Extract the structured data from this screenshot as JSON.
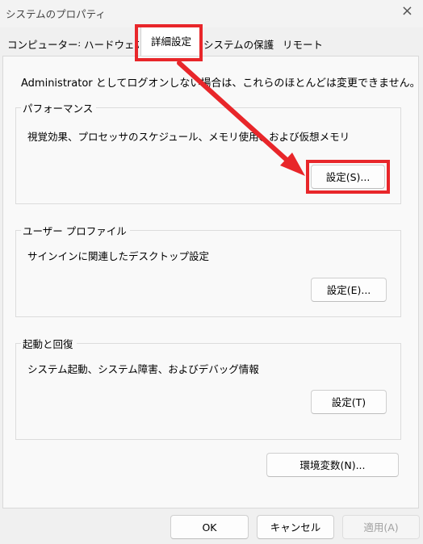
{
  "window": {
    "title": "システムのプロパティ",
    "close_symbol": "×"
  },
  "tabs": [
    {
      "label": "コンピューター名"
    },
    {
      "label": "ハードウェア"
    },
    {
      "label": "詳細設定",
      "active": true
    },
    {
      "label": "システムの保護"
    },
    {
      "label": "リモート"
    }
  ],
  "notice": "Administrator としてログオンしない場合は、これらのほとんどは変更できません。",
  "performance": {
    "legend": "パフォーマンス",
    "description": "視覚効果、プロセッサのスケジュール、メモリ使用、および仮想メモリ",
    "button": "設定(S)..."
  },
  "user_profiles": {
    "legend": "ユーザー プロファイル",
    "description": "サインインに関連したデスクトップ設定",
    "button": "設定(E)..."
  },
  "startup_recovery": {
    "legend": "起動と回復",
    "description": "システム起動、システム障害、およびデバッグ情報",
    "button": "設定(T)"
  },
  "env_button": "環境変数(N)...",
  "footer": {
    "ok": "OK",
    "cancel": "キャンセル",
    "apply": "適用(A)"
  },
  "annotation_color": "#e8262a"
}
